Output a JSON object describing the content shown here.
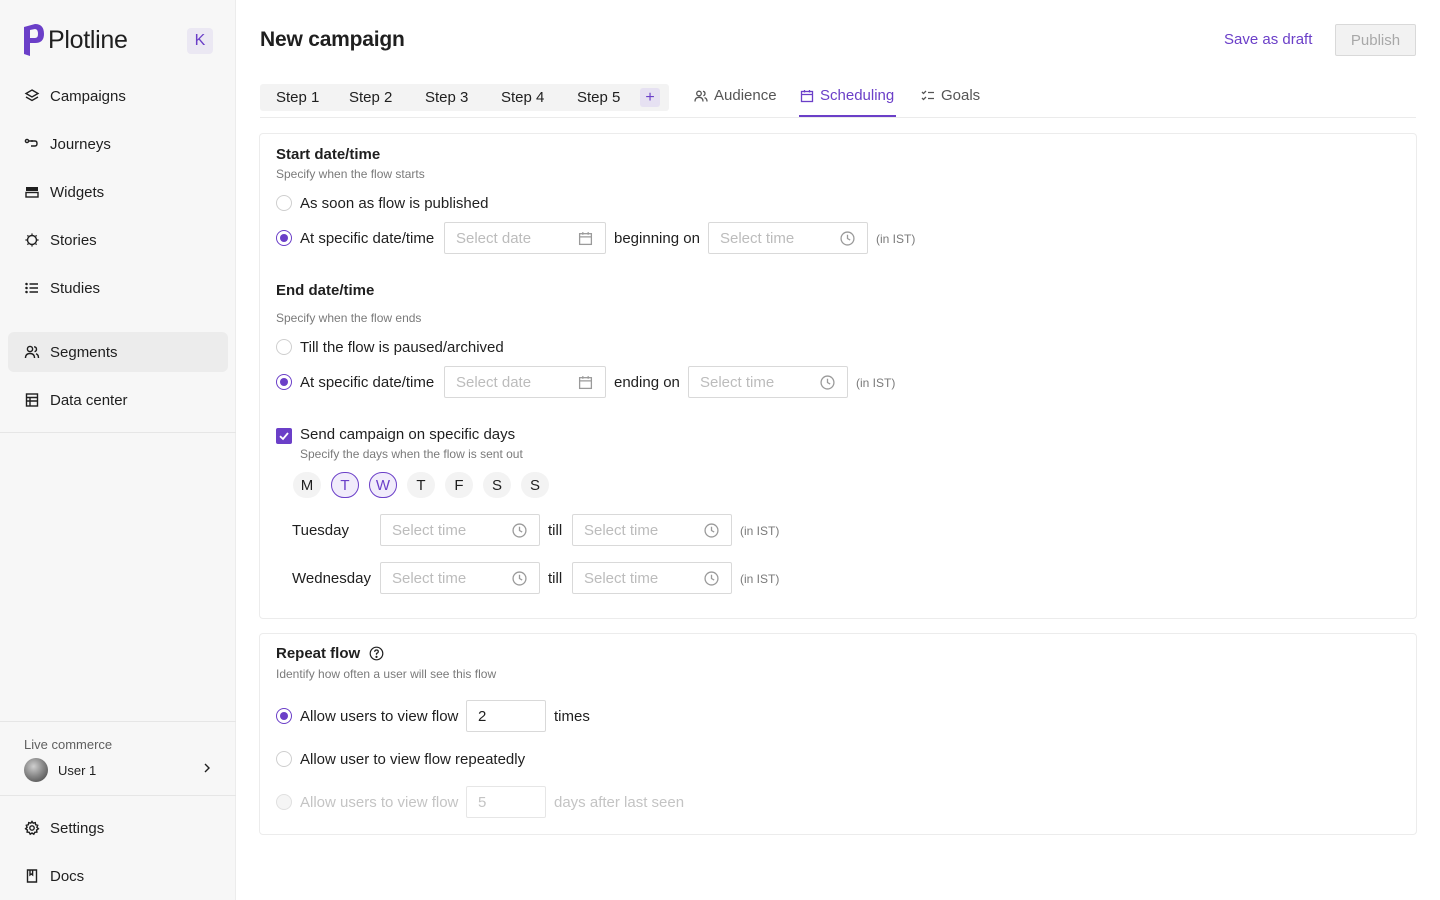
{
  "brand": {
    "name": "Plotline",
    "collapse_label": "K",
    "accent": "#6b3fc8"
  },
  "sidebar": {
    "items": [
      {
        "label": "Campaigns",
        "icon": "layers-icon"
      },
      {
        "label": "Journeys",
        "icon": "route-icon"
      },
      {
        "label": "Widgets",
        "icon": "widget-icon"
      },
      {
        "label": "Stories",
        "icon": "stories-icon"
      },
      {
        "label": "Studies",
        "icon": "list-icon"
      },
      {
        "label": "Segments",
        "icon": "users-icon",
        "active": true
      },
      {
        "label": "Data center",
        "icon": "table-icon"
      }
    ],
    "org": {
      "title": "Live commerce",
      "user": "User 1"
    },
    "bottom_items": [
      {
        "label": "Settings",
        "icon": "gear-icon"
      },
      {
        "label": "Docs",
        "icon": "book-icon"
      }
    ]
  },
  "header": {
    "title": "New campaign",
    "save_draft": "Save as draft",
    "publish": "Publish"
  },
  "steps": [
    "Step 1",
    "Step 2",
    "Step 3",
    "Step 4",
    "Step 5"
  ],
  "add_step": "+",
  "tabs": [
    {
      "label": "Audience",
      "icon": "audience-icon",
      "active": false
    },
    {
      "label": "Scheduling",
      "icon": "calendar-icon",
      "active": true
    },
    {
      "label": "Goals",
      "icon": "checklist-icon",
      "active": false
    }
  ],
  "start": {
    "title": "Start date/time",
    "subtitle": "Specify when the flow starts",
    "option_published": "As soon as flow is published",
    "option_specific": "At specific date/time",
    "date_placeholder": "Select date",
    "connector": "beginning on",
    "time_placeholder": "Select time",
    "tz": "(in IST)"
  },
  "end": {
    "title": "End date/time",
    "subtitle": "Specify when the flow ends",
    "option_paused": "Till the flow is paused/archived",
    "option_specific": "At specific date/time",
    "date_placeholder": "Select date",
    "connector": "ending on",
    "time_placeholder": "Select time",
    "tz": "(in IST)"
  },
  "days": {
    "title": "Send campaign on specific days",
    "subtitle": "Specify the days when the flow is sent out",
    "labels": [
      "M",
      "T",
      "W",
      "T",
      "F",
      "S",
      "S"
    ],
    "selected": [
      1,
      2
    ],
    "rows": [
      {
        "day": "Tuesday",
        "from_placeholder": "Select time",
        "till": "till",
        "to_placeholder": "Select time",
        "tz": "(in IST)"
      },
      {
        "day": "Wednesday",
        "from_placeholder": "Select time",
        "till": "till",
        "to_placeholder": "Select time",
        "tz": "(in IST)"
      }
    ]
  },
  "repeat": {
    "title": "Repeat flow",
    "subtitle": "Identify how often a user will see this flow",
    "option_times_label": "Allow users to view flow",
    "option_times_value": "2",
    "option_times_suffix": "times",
    "option_repeat": "Allow user to view flow repeatedly",
    "option_days_label": "Allow users to view flow",
    "option_days_value": "5",
    "option_days_suffix": "days after last seen"
  }
}
